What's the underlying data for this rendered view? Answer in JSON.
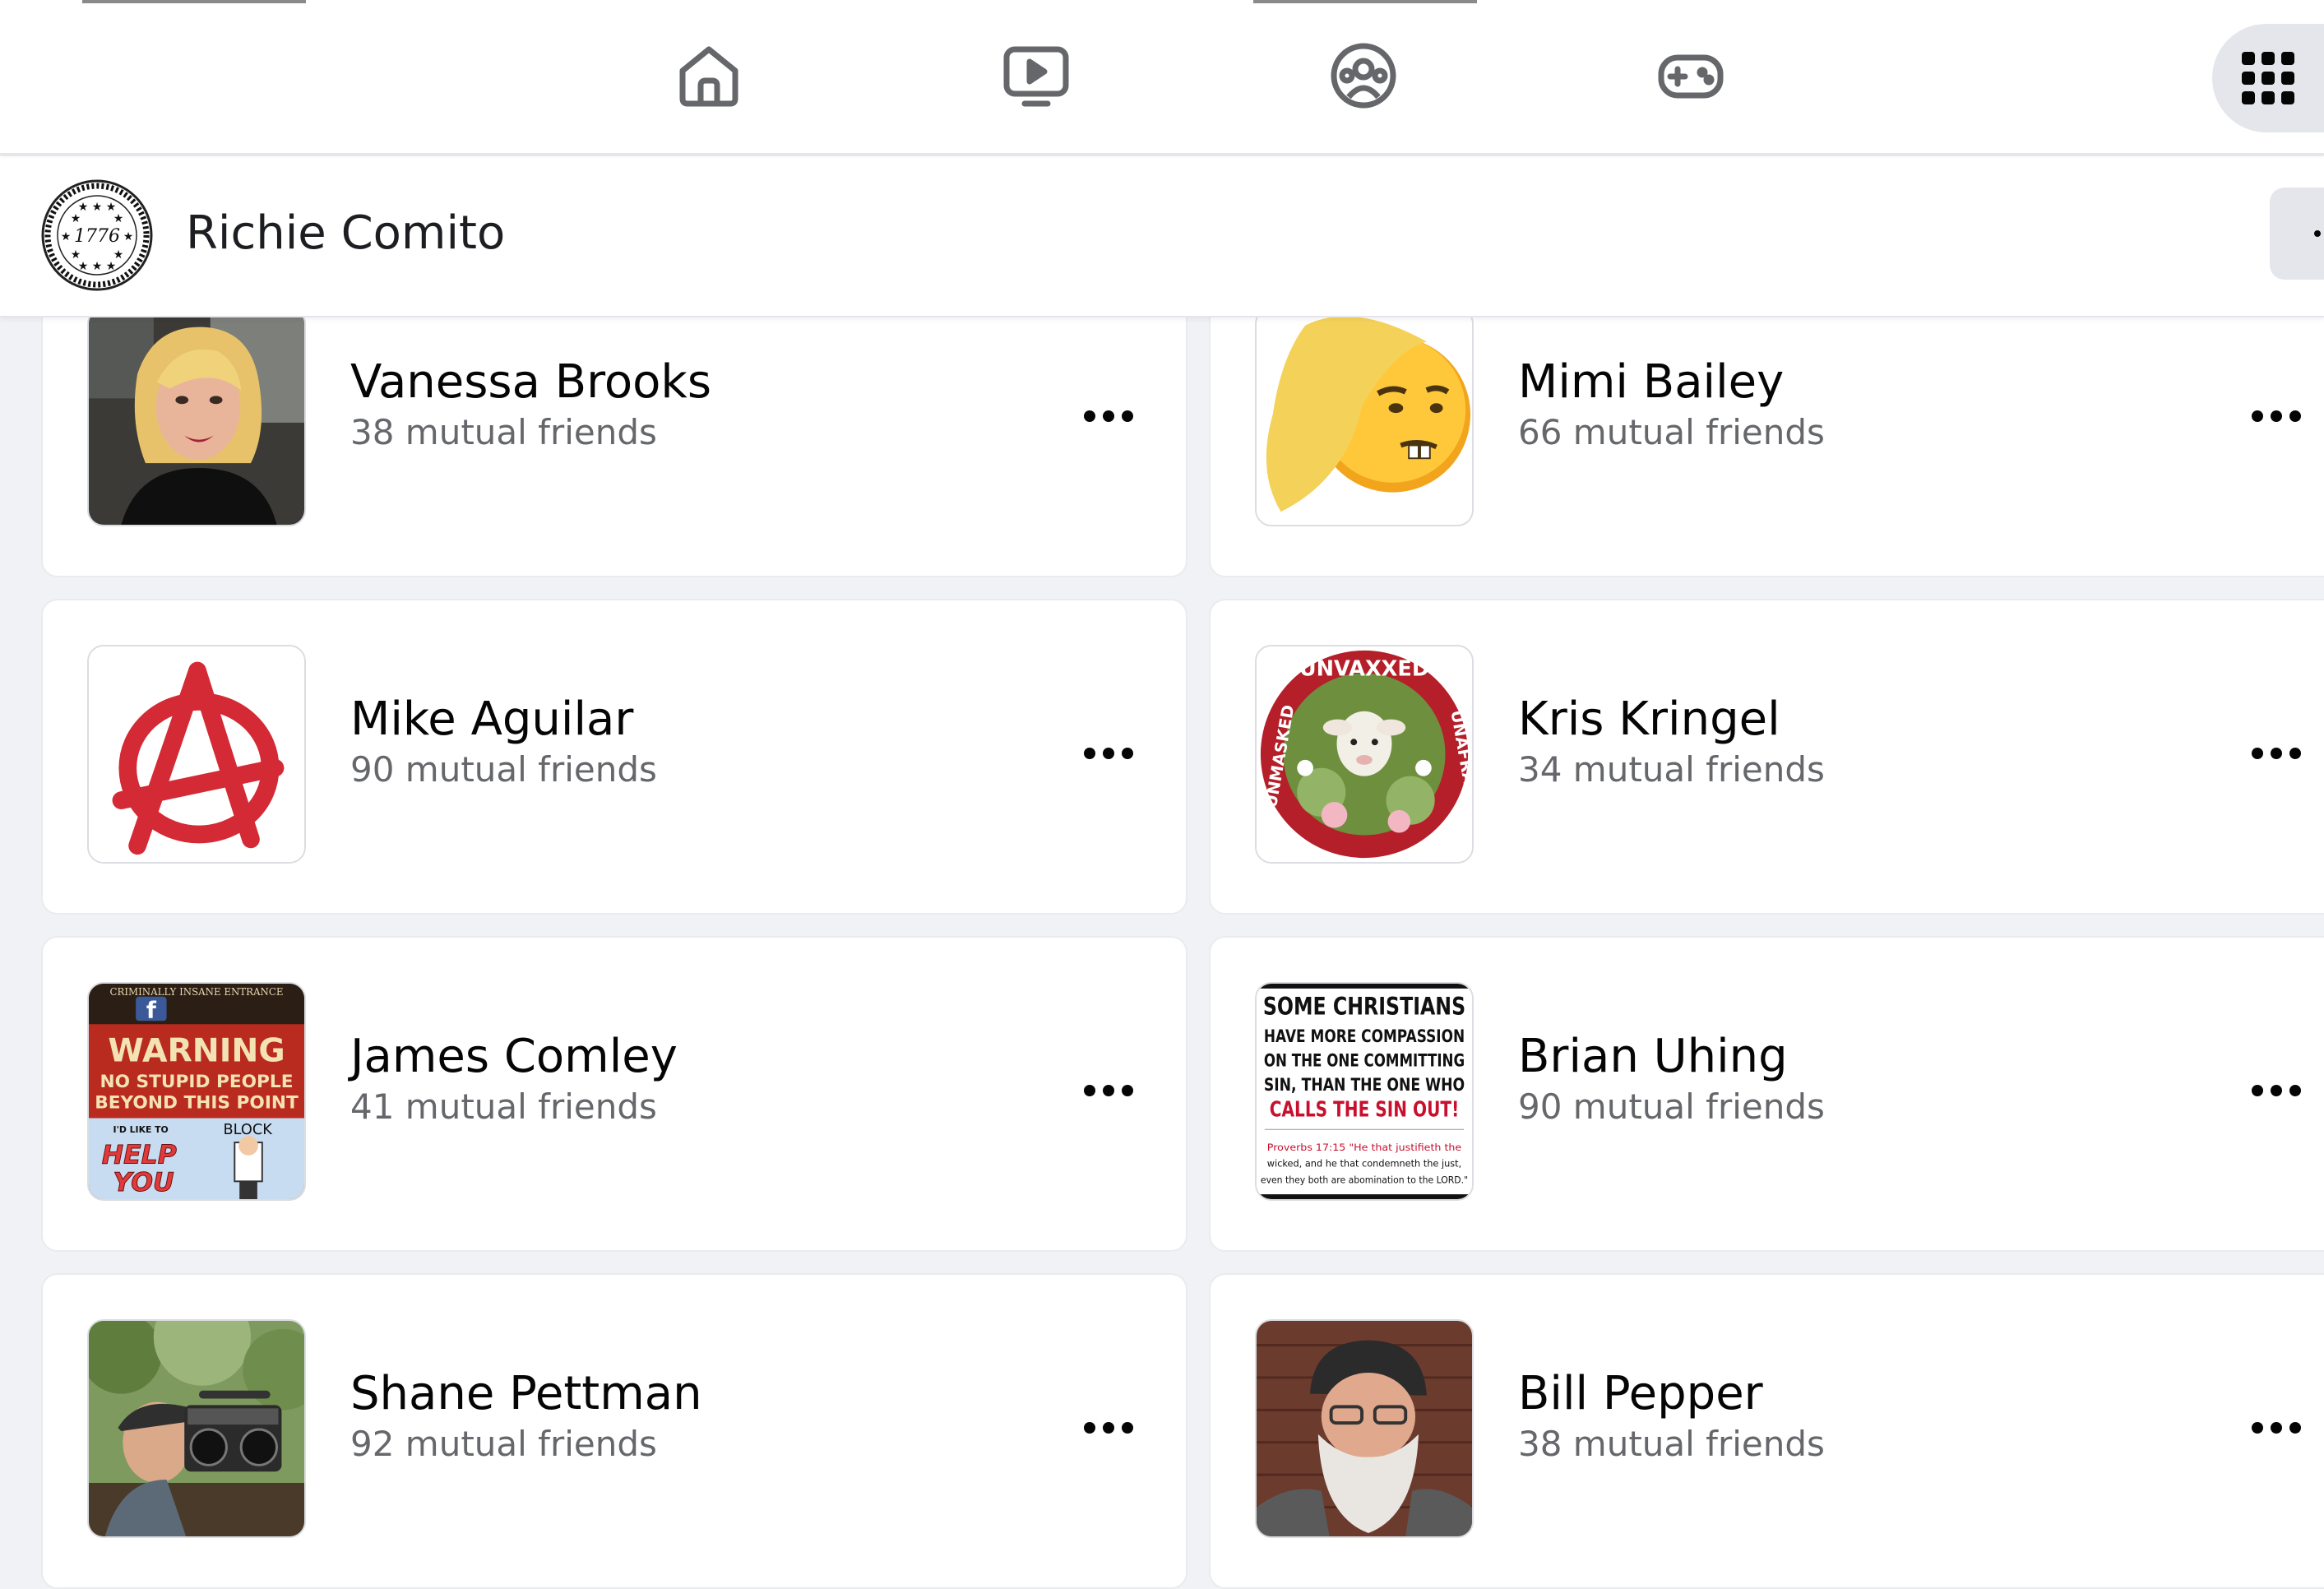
{
  "nav": {
    "items": [
      {
        "icon": "home-icon"
      },
      {
        "icon": "watch-icon"
      },
      {
        "icon": "groups-icon"
      },
      {
        "icon": "gaming-icon"
      }
    ],
    "menu_icon": "menu-grid-icon"
  },
  "profile": {
    "name": "Richie Comito",
    "avatar_icon": "1776-emblem"
  },
  "friends": [
    {
      "name": "Vanessa Brooks",
      "mutual": "38 mutual friends"
    },
    {
      "name": "Mimi Bailey",
      "mutual": "66 mutual friends"
    },
    {
      "name": "Mike Aguilar",
      "mutual": "90 mutual friends"
    },
    {
      "name": "Kris Kringel",
      "mutual": "34 mutual friends"
    },
    {
      "name": "James Comley",
      "mutual": "41 mutual friends"
    },
    {
      "name": "Brian Uhing",
      "mutual": "90 mutual friends"
    },
    {
      "name": "Shane Pettman",
      "mutual": "92 mutual friends"
    },
    {
      "name": "Bill Pepper",
      "mutual": "38 mutual friends"
    }
  ],
  "avatar_text": {
    "emblem_year": "1776",
    "kris_ring_top": "UNVAXXED",
    "kris_ring_left": "UNMASKED",
    "kris_ring_right": "UNAFRAID",
    "james_line1": "CRIMINALLY INSANE ENTRANCE",
    "james_line2": "WARNING",
    "james_line3": "NO STUPID PEOPLE",
    "james_line4": "BEYOND THIS POINT",
    "james_line5": "I'D LIKE TO",
    "james_line6": "BLOCK",
    "james_line7": "HELP",
    "james_line8": "YOU",
    "brian_line1": "SOME CHRISTIANS",
    "brian_line2": "HAVE MORE COMPASSION",
    "brian_line3": "ON THE ONE COMMITTING",
    "brian_line4": "SIN, THAN THE ONE WHO",
    "brian_line5": "CALLS THE SIN OUT!",
    "brian_line6": "Proverbs 17:15 \"He that justifieth the",
    "brian_line7": "wicked, and he that condemneth the just,",
    "brian_line8": "even they both are abomination to the LORD.\""
  },
  "colors": {
    "accent_red": "#d42a35",
    "muted_text": "#65676b",
    "card_bg": "#ffffff",
    "page_bg": "#f0f2f5"
  }
}
